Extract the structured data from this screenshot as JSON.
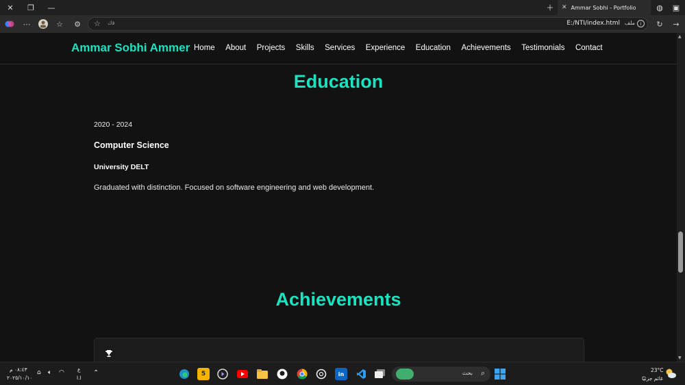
{
  "browser": {
    "tab_title": "Ammar Sobhi - Portfolio",
    "address_lang": "ﻗﻙ",
    "url": "E:/NTI/index.html",
    "scheme_label": "ملف"
  },
  "nav": {
    "brand": "Ammar Sobhi Ammer",
    "links": [
      "Home",
      "About",
      "Projects",
      "Skills",
      "Services",
      "Experience",
      "Education",
      "Achievements",
      "Testimonials",
      "Contact"
    ]
  },
  "education": {
    "title": "Education",
    "years": "2020 - 2024",
    "degree": "Computer Science",
    "school": "University DELT",
    "description": "Graduated with distinction. Focused on software engineering and web development."
  },
  "achievements": {
    "title": "Achievements"
  },
  "taskbar": {
    "time": "٠٨:٤٣ م",
    "date": "٢٠٢٥/١٠/١٠",
    "lang_top": "ع",
    "lang_bottom": "ا.ا",
    "search_placeholder": "بحث",
    "weather_temp": "23°C",
    "weather_desc": "غائم جزئيًا"
  },
  "colors": {
    "accent": "#19e3c0",
    "page_bg": "#121212"
  }
}
